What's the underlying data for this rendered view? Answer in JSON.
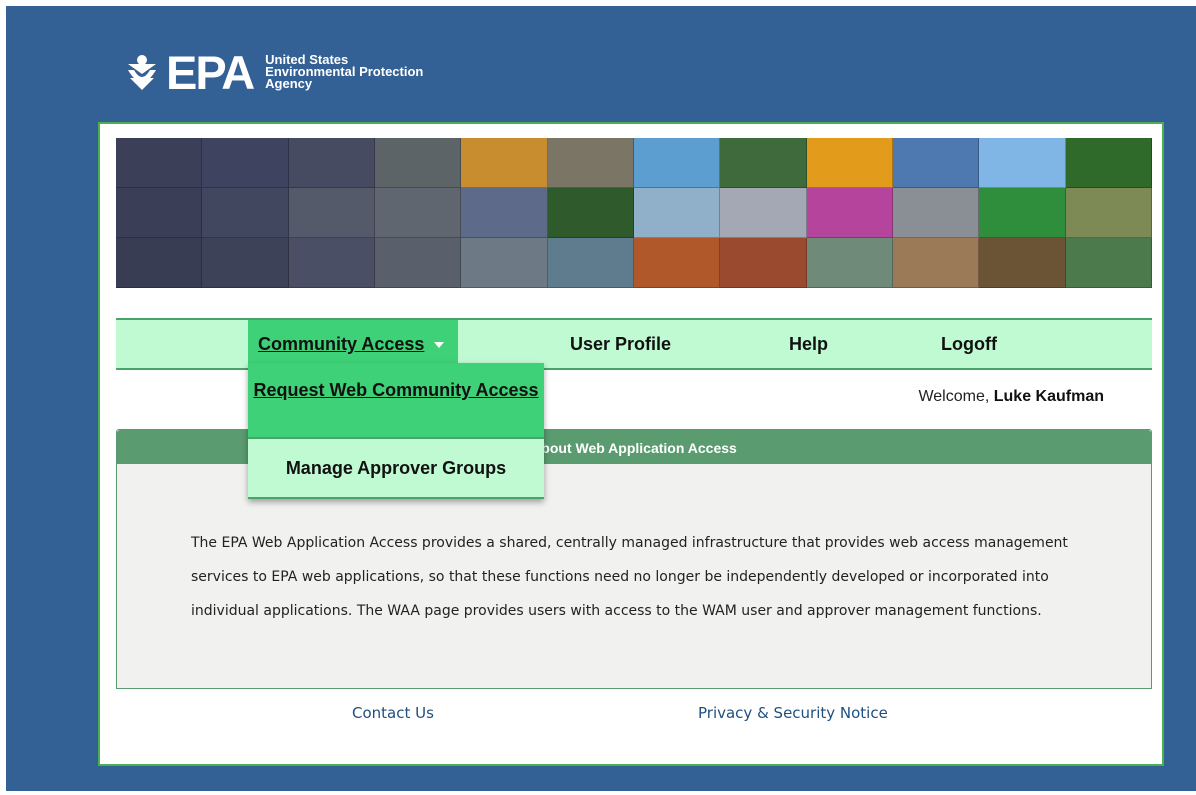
{
  "logo": {
    "letters": "EPA",
    "line1": "United States",
    "line2": "Environmental Protection",
    "line3": "Agency",
    "icon": "epa-flower-icon"
  },
  "nav": {
    "community_access": "Community Access",
    "user_profile": "User Profile",
    "help": "Help",
    "logoff": "Logoff"
  },
  "dropdown": {
    "request_access": "Request Web Community Access",
    "manage_approvers": "Manage Approver Groups"
  },
  "welcome": {
    "prefix": "Welcome,",
    "user": "Luke Kaufman"
  },
  "panel": {
    "title": "About Web Application Access",
    "body": "The EPA Web Application Access provides a shared, centrally managed infrastructure that provides web access management services to EPA web applications, so that these functions need no longer be independently developed or incorporated into individual applications. The WAA page provides users with access to the WAM user and approver management functions."
  },
  "footer": {
    "contact": "Contact Us",
    "privacy": "Privacy & Security Notice"
  },
  "colors": {
    "outer_bg": "#336195",
    "nav_bg": "#bffad3",
    "nav_active": "#3fd177",
    "panel_header": "#5a9b6f",
    "link": "#1f4f7f"
  }
}
